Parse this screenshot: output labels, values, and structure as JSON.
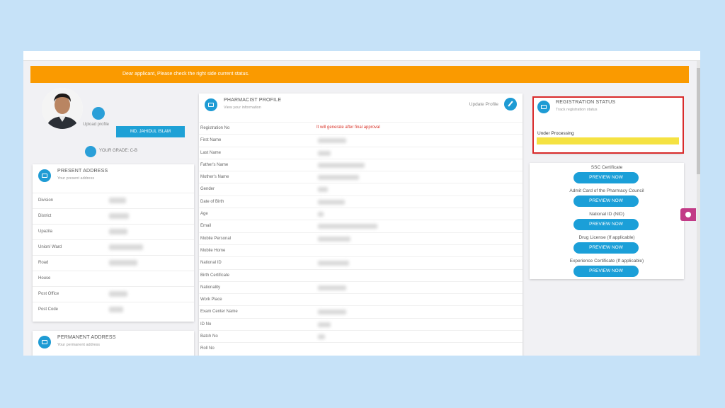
{
  "notice": "Dear applicant, Please check the right side current status.",
  "profile": {
    "upload_label": "Upload profile",
    "name": "MD. JAHIDUL ISLAM",
    "grade": "YOUR GRADE: C-B"
  },
  "present_address": {
    "title": "PRESENT ADDRESS",
    "subtitle": "Your present address",
    "rows": [
      "Division",
      "District",
      "Upazila",
      "Union/ Ward",
      "Road",
      "House",
      "Post Office",
      "Post Code"
    ]
  },
  "permanent_address": {
    "title": "PERMANENT ADDRESS",
    "subtitle": "Your permanent address"
  },
  "pharmacist_profile": {
    "title": "PHARMACIST PROFILE",
    "subtitle": "View your information",
    "update_label": "Update Profile",
    "registration_label": "Registration No",
    "registration_value": "It will generate after final approval",
    "rows": [
      "First Name",
      "Last Name",
      "Father's Name",
      "Mother's Name",
      "Gender",
      "Date of Birth",
      "Age",
      "Email",
      "Mobile Personal",
      "Mobile Home",
      "National ID",
      "Birth Certificate",
      "Nationality",
      "Work Place",
      "Exam Center Name",
      "ID No",
      "Batch No",
      "Roll No"
    ]
  },
  "registration_status": {
    "title": "REGISTRATION STATUS",
    "subtitle": "Track registration status",
    "status": "Under Processing"
  },
  "documents": {
    "button_label": "PREVIEW NOW",
    "items": [
      "SSC Certificate",
      "Admit Card of the Pharmacy Council",
      "National ID (NID)",
      "Drug License (If applicable)",
      "Experience Certificate (If applicable)"
    ]
  },
  "colors": {
    "notice_bg": "#fa9a00",
    "accent": "#1e9bd4",
    "status_bar": "#f5e242",
    "highlight_border": "#d92b2b"
  }
}
